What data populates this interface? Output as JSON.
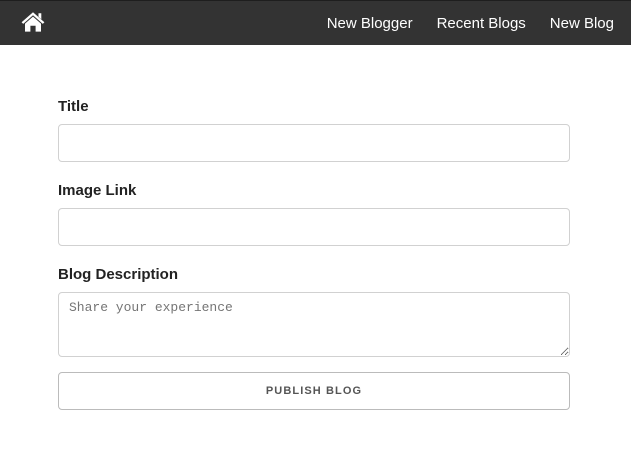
{
  "navbar": {
    "home_icon": "home-icon",
    "links": [
      {
        "label": "New Blogger"
      },
      {
        "label": "Recent Blogs"
      },
      {
        "label": "New Blog"
      }
    ]
  },
  "form": {
    "title_label": "Title",
    "title_value": "",
    "image_link_label": "Image Link",
    "image_link_value": "",
    "description_label": "Blog Description",
    "description_placeholder": "Share your experience",
    "description_value": "",
    "publish_label": "Publish Blog"
  },
  "colors": {
    "navbar_bg": "#333333",
    "nav_text": "#ffffff",
    "input_border": "#d1d1d1",
    "button_text": "#555555"
  }
}
